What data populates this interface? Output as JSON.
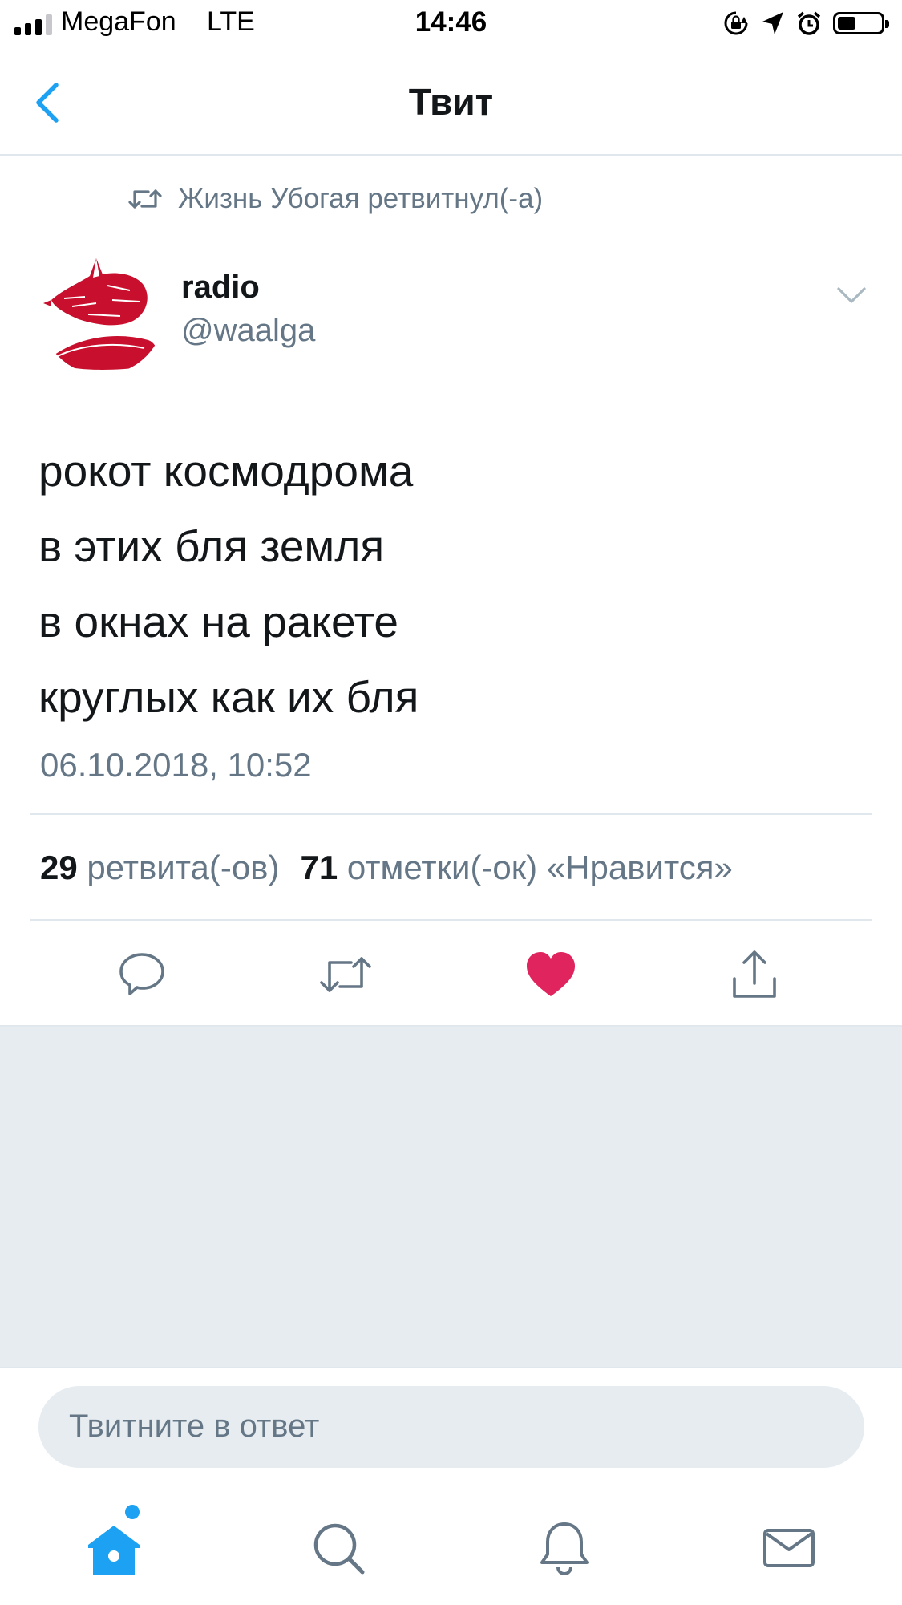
{
  "status_bar": {
    "carrier": "MegaFon",
    "network": "LTE",
    "time": "14:46"
  },
  "nav": {
    "title": "Твит"
  },
  "tweet": {
    "retweeted_by": "Жизнь Убогая ретвитнул(-а)",
    "author_name": "radio",
    "author_handle": "@waalga",
    "lines": [
      "рокот космодрома",
      "в этих бля земля",
      "в окнах на ракете",
      "круглых как их бля"
    ],
    "timestamp": "06.10.2018, 10:52",
    "retweet_count": "29",
    "retweet_label": "ретвита(-ов)",
    "like_count": "71",
    "like_label": "отметки(-ок) «Нравится»",
    "liked": true
  },
  "reply": {
    "placeholder": "Твитните в ответ"
  },
  "colors": {
    "accent": "#1da1f2",
    "like": "#e0245e",
    "muted": "#657786",
    "divider": "#e1e8ed",
    "panel": "#e6ecf0",
    "avatar": "#c8102e"
  },
  "tab_bar": {
    "items": [
      "home-icon",
      "search-icon",
      "notifications-icon",
      "messages-icon"
    ],
    "home_has_new": true
  }
}
